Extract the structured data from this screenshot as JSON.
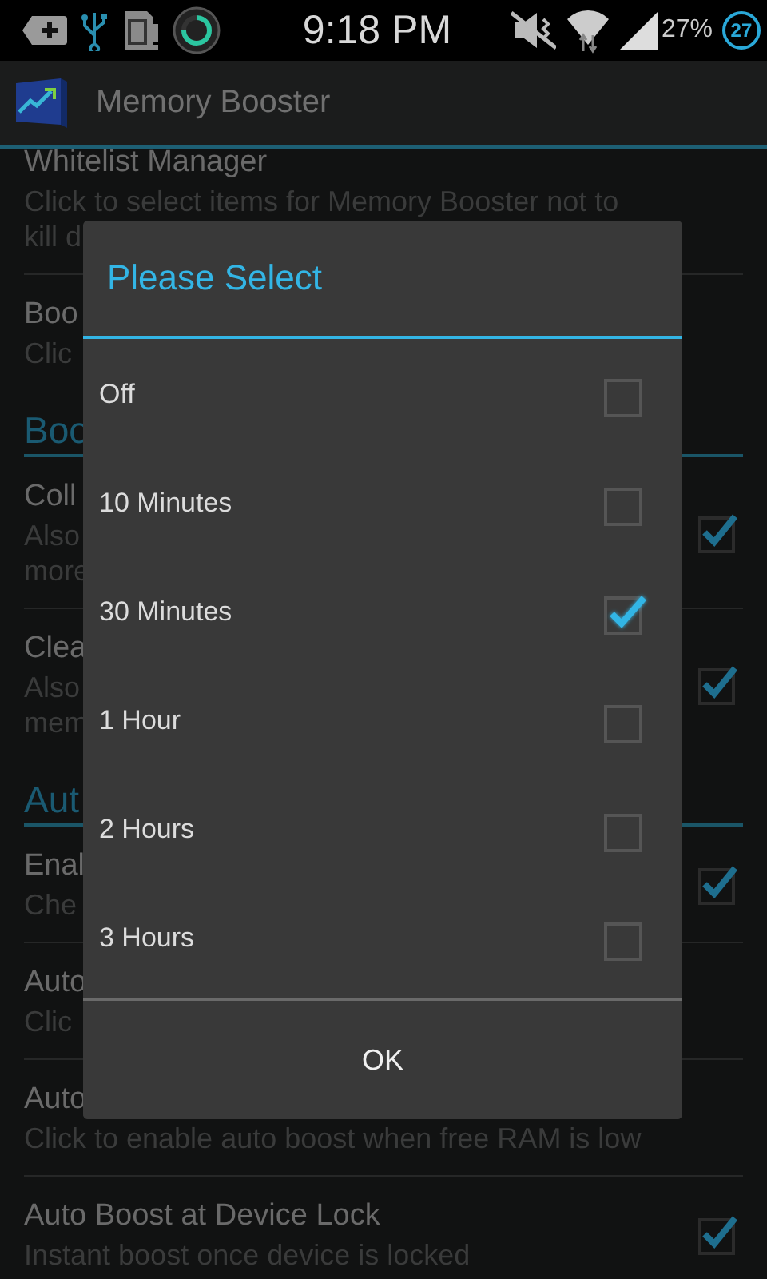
{
  "status_bar": {
    "time": "9:18 PM",
    "battery_percent": "27%",
    "battery_badge": "27"
  },
  "app_bar": {
    "title": "Memory Booster"
  },
  "preferences": [
    {
      "kind": "pref",
      "title": "Whitelist Manager",
      "summary_lines": [
        "Click to select items for Memory Booster not to",
        "kill d"
      ]
    },
    {
      "kind": "pref",
      "title": "Boo",
      "summary_lines": [
        "Clic"
      ]
    },
    {
      "kind": "category",
      "title": "Boo"
    },
    {
      "kind": "checkbox_pref",
      "title": "Coll",
      "summary_lines": [
        "Also",
        "more"
      ],
      "checked": true
    },
    {
      "kind": "checkbox_pref",
      "title": "Clea",
      "summary_lines": [
        "Also",
        "mem"
      ],
      "checked": true
    },
    {
      "kind": "category",
      "title": "Aut"
    },
    {
      "kind": "checkbox_pref",
      "title": "Enal",
      "summary_lines": [
        "Che"
      ],
      "checked": true
    },
    {
      "kind": "pref",
      "title": "Auto",
      "summary_lines": [
        "Clic"
      ]
    },
    {
      "kind": "pref",
      "title": "Auto",
      "summary_lines": [
        "Click to enable auto boost when free RAM is low"
      ]
    },
    {
      "kind": "checkbox_pref",
      "title": "Auto Boost at Device Lock",
      "summary_lines": [
        "Instant boost once device is locked"
      ],
      "checked": true
    }
  ],
  "dialog": {
    "title": "Please Select",
    "options": [
      {
        "label": "Off",
        "checked": false
      },
      {
        "label": "10 Minutes",
        "checked": false
      },
      {
        "label": "30 Minutes",
        "checked": true
      },
      {
        "label": "1 Hour",
        "checked": false
      },
      {
        "label": "2 Hours",
        "checked": false
      },
      {
        "label": "3 Hours",
        "checked": false
      }
    ],
    "button": "OK"
  }
}
